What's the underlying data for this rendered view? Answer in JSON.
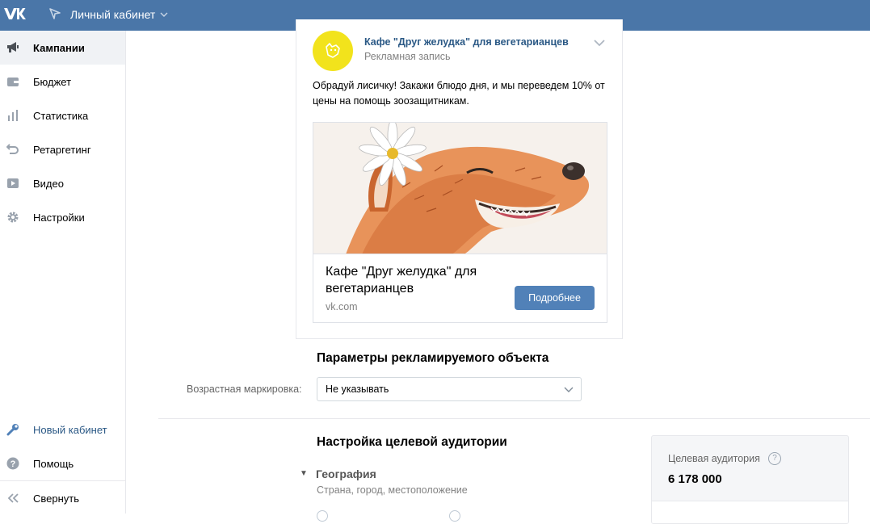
{
  "header": {
    "logo": "vk-logo-icon",
    "cabinet_label": "Личный кабинет",
    "brand_color": "#4a76a8"
  },
  "sidebar": {
    "items": [
      {
        "label": "Кампании",
        "icon": "megaphone-icon",
        "active": true
      },
      {
        "label": "Бюджет",
        "icon": "wallet-icon"
      },
      {
        "label": "Статистика",
        "icon": "bar-chart-icon"
      },
      {
        "label": "Ретаргетинг",
        "icon": "retarget-arrow-icon"
      },
      {
        "label": "Видео",
        "icon": "video-play-icon"
      },
      {
        "label": "Настройки",
        "icon": "gear-icon"
      }
    ],
    "bottom": [
      {
        "label": "Новый кабинет",
        "icon": "wrench-icon"
      },
      {
        "label": "Помощь",
        "icon": "help-icon"
      },
      {
        "label": "Свернуть",
        "icon": "collapse-icon"
      }
    ]
  },
  "post": {
    "author": "Кафе \"Друг желудка\" для вегетарианцев",
    "subtitle": "Рекламная запись",
    "text": "Обрадуй лисичку! Закажи блюдо дня, и мы переведем 10% от цены на помощь зоозащитникам.",
    "attachment": {
      "title": "Кафе \"Друг желудка\" для вегетарианцев",
      "domain": "vk.com",
      "button": "Подробнее"
    }
  },
  "params": {
    "title": "Параметры рекламируемого объекта",
    "age_label": "Возрастная маркировка:",
    "age_value": "Не указывать"
  },
  "audience": {
    "title": "Настройка целевой аудитории",
    "geo_title": "География",
    "geo_sub": "Страна, город, местоположение",
    "target_label": "Целевая аудитория",
    "help": "?",
    "target_value": "6 178 000"
  }
}
